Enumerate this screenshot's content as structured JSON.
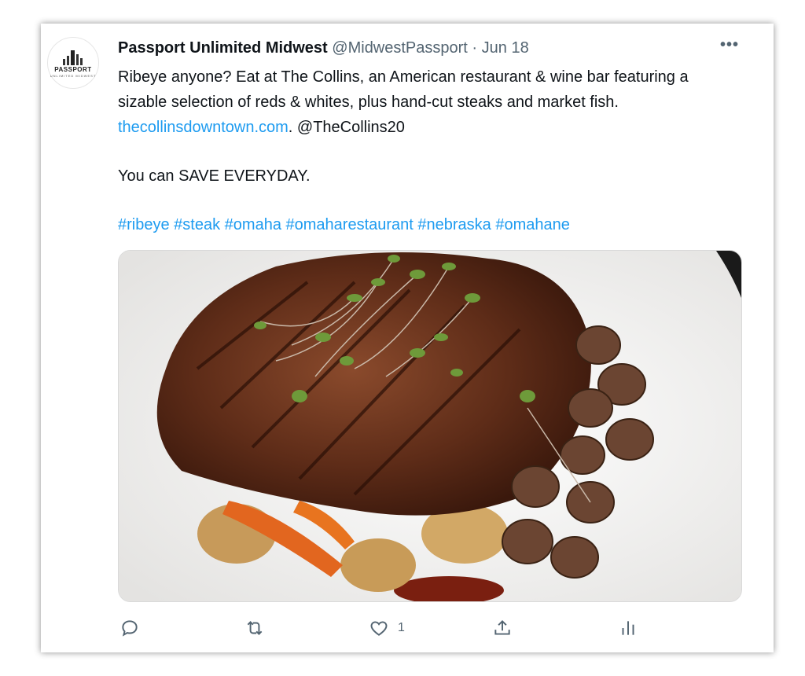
{
  "tweet": {
    "author_name": "Passport Unlimited Midwest",
    "handle": "@MidwestPassport",
    "separator": "·",
    "date": "Jun 18",
    "more_label": "•••",
    "avatar": {
      "brand": "PASSPORT",
      "sub": "UNLIMITED MIDWEST"
    },
    "text_line1_prefix": "Ribeye anyone? Eat at The Collins, an American restaurant & wine bar featuring a sizable selection of reds & whites, plus hand-cut steaks and market fish.",
    "link": "thecollinsdowntown.com",
    "text_line1_suffix": ". @TheCollins20",
    "text_line2": "You can SAVE EVERYDAY.",
    "hashtags": [
      "#ribeye",
      "#steak",
      "#omaha",
      "#omaharestaurant",
      "#nebraska",
      "#omahane"
    ],
    "photo_icon": "ribeye-steak-photo",
    "actions": {
      "reply_icon": "reply-icon",
      "retweet_icon": "retweet-icon",
      "like_icon": "heart-icon",
      "like_count": "1",
      "share_icon": "share-icon",
      "analytics_icon": "analytics-icon"
    }
  },
  "colors": {
    "link": "#1d9bf0",
    "secondary_text": "#536471",
    "primary_text": "#0f1419"
  }
}
